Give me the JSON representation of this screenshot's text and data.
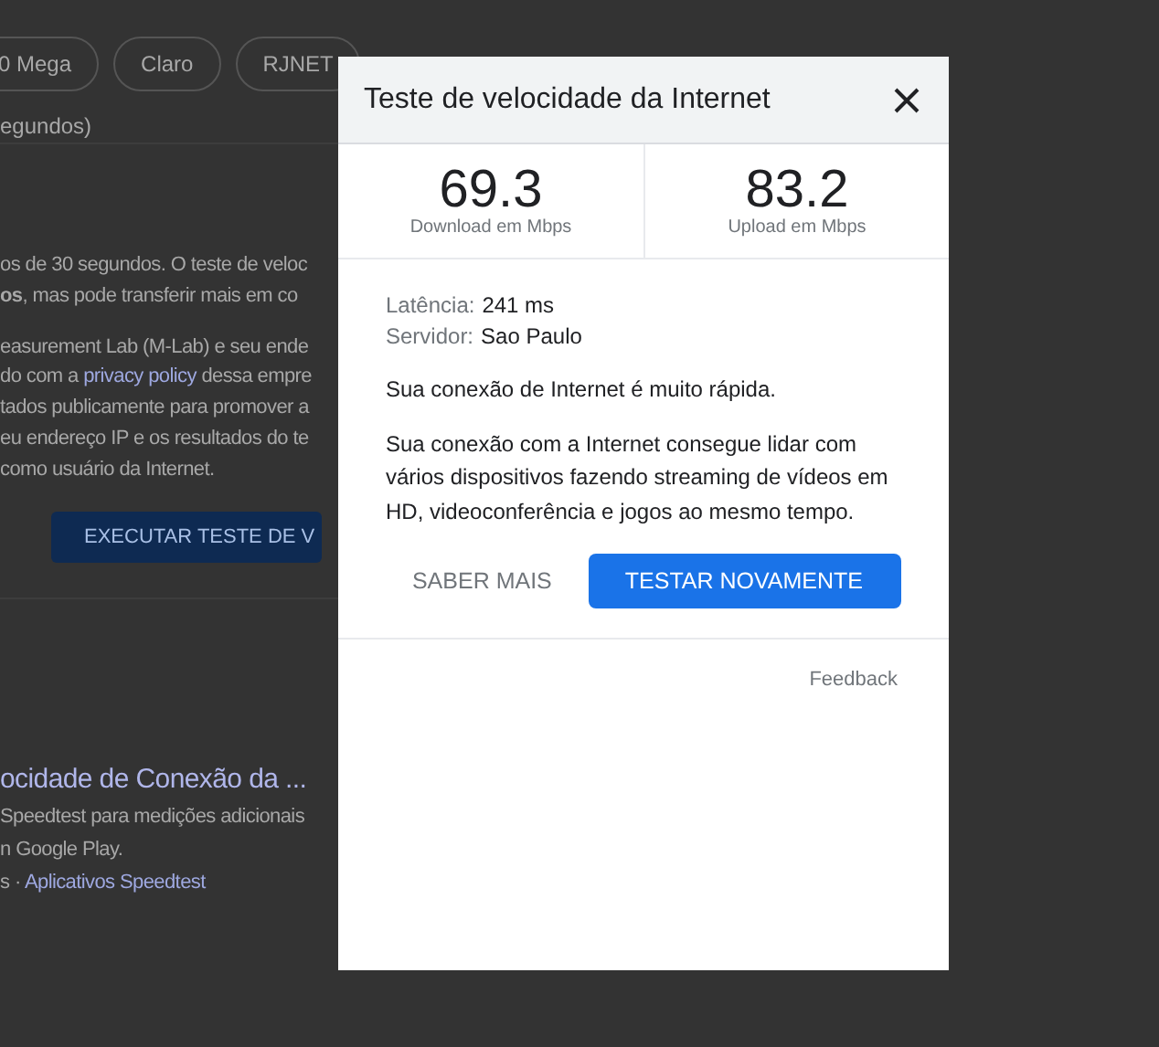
{
  "background_page": {
    "chips": [
      {
        "label": "0 Mega"
      },
      {
        "label": "Claro"
      },
      {
        "label": "RJNET"
      }
    ],
    "duration_note": "egundos)",
    "paragraphs": [
      [
        [
          {
            "text": "os de 30 segundos. O teste de veloc"
          }
        ],
        [
          {
            "text": "**os**, mas pode transferir mais em co"
          }
        ]
      ],
      [
        [
          {
            "text": "easurement Lab (M-Lab) e seu ende"
          }
        ],
        [
          {
            "text": "do com a "
          },
          {
            "text": "privacy policy",
            "kind": "link"
          },
          {
            "text": " dessa empre"
          }
        ],
        [
          {
            "text": "tados publicamente para promover a"
          }
        ],
        [
          {
            "text": "eu endereço IP e os resultados do te"
          }
        ],
        [
          {
            "text": " como usuário da Internet."
          }
        ]
      ]
    ],
    "run_button": "EXECUTAR TESTE DE V",
    "result": {
      "title": "ocidade de Conexão da ...",
      "lines": [
        [
          {
            "text": "Speedtest para medições adicionais"
          }
        ],
        [
          {
            "text": "n Google Play."
          }
        ],
        [
          {
            "text": "s · "
          },
          {
            "text": "Aplicativos Speedtest",
            "kind": "link"
          }
        ]
      ]
    }
  },
  "dialog": {
    "title": "Teste de velocidade da Internet",
    "stats": [
      {
        "value": "69.3",
        "label": "Download em Mbps"
      },
      {
        "value": "83.2",
        "label": "Upload em Mbps"
      }
    ],
    "details": [
      {
        "label": "Latência:",
        "value": "241 ms"
      },
      {
        "label": "Servidor:",
        "value": "Sao Paulo"
      }
    ],
    "summary": "Sua conexão de Internet é muito rápida.",
    "description": "Sua conexão com a Internet consegue lidar com vários dispositivos fazendo streaming de vídeos em HD, videoconferência e jogos ao mesmo tempo.",
    "buttons": [
      {
        "label": "SABER MAIS",
        "kind": "text"
      },
      {
        "label": "TESTAR NOVAMENTE",
        "kind": "primary"
      }
    ],
    "feedback": "Feedback"
  }
}
